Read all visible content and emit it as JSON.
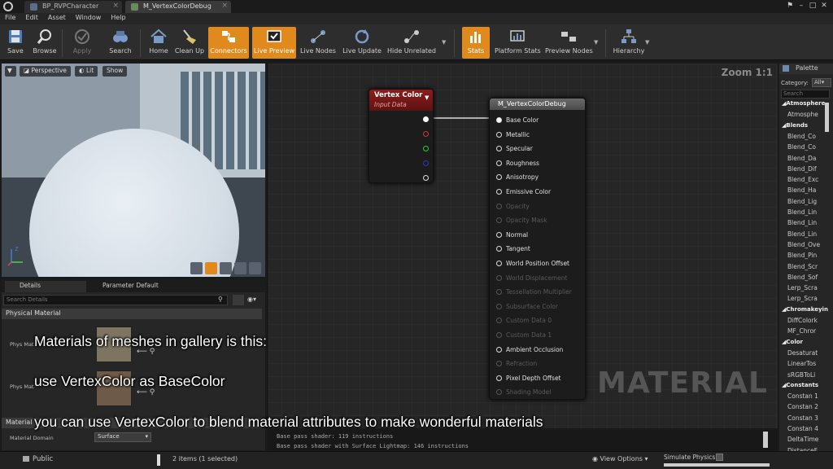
{
  "tabs": [
    {
      "label": "BP_RVPCharacter"
    },
    {
      "label": "M_VertexColorDebug"
    }
  ],
  "menu": [
    "File",
    "Edit",
    "Asset",
    "Window",
    "Help"
  ],
  "toolbar": {
    "save": "Save",
    "browse": "Browse",
    "apply": "Apply",
    "search": "Search",
    "home": "Home",
    "cleanup": "Clean Up",
    "connectors": "Connectors",
    "livepreview": "Live Preview",
    "livenodes": "Live Nodes",
    "liveupdate": "Live Update",
    "hideunrelated": "Hide Unrelated",
    "stats": "Stats",
    "platformstats": "Platform Stats",
    "previewnodes": "Preview Nodes",
    "hierarchy": "Hierarchy"
  },
  "viewport": {
    "perspective": "Perspective",
    "lit": "Lit",
    "show": "Show"
  },
  "details": {
    "tab1": "Details",
    "tab2": "Parameter Default",
    "search_placeholder": "Search Details",
    "sec1": "Physical Material",
    "prop1": "Phys Mat",
    "prop2": "Phys Mat",
    "sec2": "Material",
    "domain_label": "Material Domain",
    "domain_value": "Surface"
  },
  "graph": {
    "zoom": "Zoom 1:1",
    "watermark": "MATERIAL"
  },
  "vc_node": {
    "title": "Vertex Color",
    "subtitle": "Input Data"
  },
  "mat_node": {
    "title": "M_VertexColorDebug",
    "pins": [
      {
        "label": "Base Color",
        "on": true
      },
      {
        "label": "Metallic",
        "on": true
      },
      {
        "label": "Specular",
        "on": true
      },
      {
        "label": "Roughness",
        "on": true
      },
      {
        "label": "Anisotropy",
        "on": true
      },
      {
        "label": "Emissive Color",
        "on": true
      },
      {
        "label": "Opacity",
        "on": false
      },
      {
        "label": "Opacity Mask",
        "on": false
      },
      {
        "label": "Normal",
        "on": true
      },
      {
        "label": "Tangent",
        "on": true
      },
      {
        "label": "World Position Offset",
        "on": true
      },
      {
        "label": "World Displacement",
        "on": false
      },
      {
        "label": "Tessellation Multiplier",
        "on": false
      },
      {
        "label": "Subsurface Color",
        "on": false
      },
      {
        "label": "Custom Data 0",
        "on": false
      },
      {
        "label": "Custom Data 1",
        "on": false
      },
      {
        "label": "Ambient Occlusion",
        "on": true
      },
      {
        "label": "Refraction",
        "on": false
      },
      {
        "label": "Pixel Depth Offset",
        "on": true
      },
      {
        "label": "Shading Model",
        "on": false
      }
    ]
  },
  "stats": {
    "line1": "Base pass shader: 119 instructions",
    "line2": "Base pass shader with Surface Lightmap: 146 instructions"
  },
  "palette": {
    "title": "Palette",
    "category_label": "Category:",
    "category_value": "All",
    "search_placeholder": "Search",
    "items": [
      {
        "t": "cat",
        "label": "Atmosphere"
      },
      {
        "t": "item",
        "label": "Atmosphe"
      },
      {
        "t": "cat",
        "label": "Blends"
      },
      {
        "t": "item",
        "label": "Blend_Co"
      },
      {
        "t": "item",
        "label": "Blend_Co"
      },
      {
        "t": "item",
        "label": "Blend_Da"
      },
      {
        "t": "item",
        "label": "Blend_Dif"
      },
      {
        "t": "item",
        "label": "Blend_Exc"
      },
      {
        "t": "item",
        "label": "Blend_Ha"
      },
      {
        "t": "item",
        "label": "Blend_Lig"
      },
      {
        "t": "item",
        "label": "Blend_Lin"
      },
      {
        "t": "item",
        "label": "Blend_Lin"
      },
      {
        "t": "item",
        "label": "Blend_Lin"
      },
      {
        "t": "item",
        "label": "Blend_Ove"
      },
      {
        "t": "item",
        "label": "Blend_Pin"
      },
      {
        "t": "item",
        "label": "Blend_Scr"
      },
      {
        "t": "item",
        "label": "Blend_Sof"
      },
      {
        "t": "item",
        "label": "Lerp_Scra"
      },
      {
        "t": "item",
        "label": "Lerp_Scra"
      },
      {
        "t": "cat",
        "label": "Chromakeyin"
      },
      {
        "t": "item",
        "label": "DiffColork"
      },
      {
        "t": "item",
        "label": "MF_Chror"
      },
      {
        "t": "cat",
        "label": "Color"
      },
      {
        "t": "item",
        "label": "Desaturat"
      },
      {
        "t": "item",
        "label": "LinearTos"
      },
      {
        "t": "item",
        "label": "sRGBToLi"
      },
      {
        "t": "cat",
        "label": "Constants"
      },
      {
        "t": "item",
        "label": "Constan 1"
      },
      {
        "t": "item",
        "label": "Constan 2"
      },
      {
        "t": "item",
        "label": "Constan 3"
      },
      {
        "t": "item",
        "label": "Constan 4"
      },
      {
        "t": "item",
        "label": "DeltaTime"
      },
      {
        "t": "item",
        "label": "DistanceF"
      }
    ]
  },
  "statusbar": {
    "public": "Public",
    "items": "2 items (1 selected)",
    "viewoptions": "View Options",
    "simphys": "Simulate Physics"
  },
  "captions": {
    "line1": "Materials of meshes in gallery is this:",
    "line2": "use VertexColor as BaseColor",
    "line3": "you can use VertexColor to blend material attributes to make wonderful materials"
  },
  "colors": {
    "accent": "#e08a1e",
    "node_header": "#8c1d1d"
  }
}
